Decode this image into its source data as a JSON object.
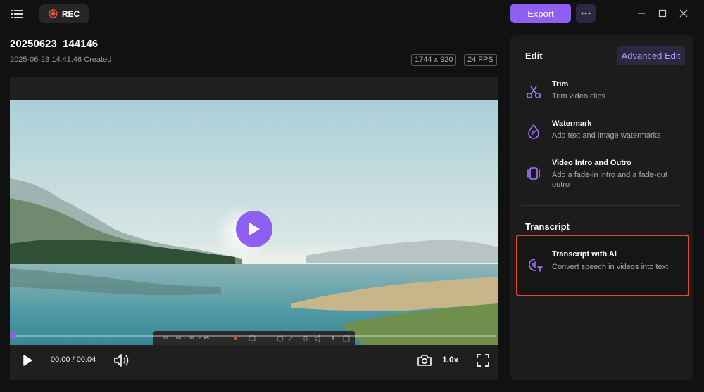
{
  "topbar": {
    "rec_label": "REC",
    "export_label": "Export"
  },
  "video": {
    "title": "20250623_144146",
    "created": "2025-06-23 14:41:46 Created",
    "resolution": "1744 x 920",
    "fps": "24 FPS"
  },
  "player": {
    "time": "00:00 / 00:04",
    "speed": "1.0x",
    "progress": 0,
    "overlay_time": "00 : 00 : 00",
    "overlay_size": "0 KB"
  },
  "panel": {
    "edit_heading": "Edit",
    "advanced_edit_label": "Advanced Edit",
    "features": [
      {
        "title": "Trim",
        "desc": "Trim video clips"
      },
      {
        "title": "Watermark",
        "desc": "Add text and image watermarks"
      },
      {
        "title": "Video Intro and Outro",
        "desc": "Add a fade-in intro and a fade-out outro"
      }
    ],
    "transcript_heading": "Transcript",
    "transcript": {
      "title": "Transcript with AI",
      "desc": "Convert speech in videos into text"
    }
  },
  "colors": {
    "accent": "#8f5ff2",
    "highlight_border": "#e34a2b",
    "background": "#111111",
    "panel": "#1c1c1c"
  }
}
